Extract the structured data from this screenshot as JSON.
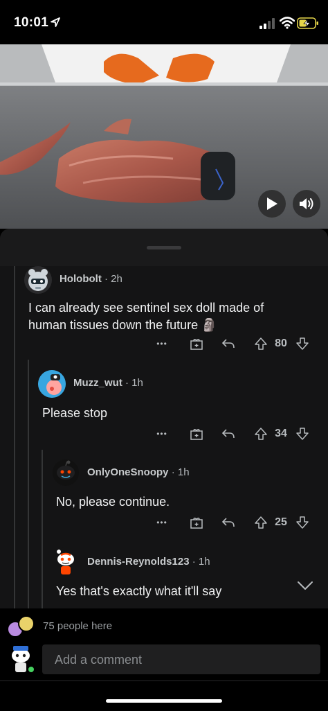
{
  "status_bar": {
    "time": "10:01"
  },
  "video": {
    "play_icon": "play-icon",
    "sound_icon": "speaker-icon"
  },
  "comments": [
    {
      "user": "Holobolt",
      "age": "2h",
      "text": "I can already see sentinel sex doll made of human tissues down the future",
      "emoji": "🗿",
      "votes": "80"
    },
    {
      "user": "Muzz_wut",
      "age": "1h",
      "text": "Please stop",
      "votes": "34"
    },
    {
      "user": "OnlyOneSnoopy",
      "age": "1h",
      "text": "No, please continue.",
      "votes": "25"
    },
    {
      "user": "Dennis-Reynolds123",
      "age": "1h",
      "text": "Yes that's exactly what it'll say"
    }
  ],
  "meta_separator": "·",
  "more_label": "•••",
  "footer": {
    "people_here": "75 people here",
    "comment_placeholder": "Add a comment"
  },
  "colors": {
    "sheet": "#1a1a1b",
    "comments_bg": "#141415",
    "text": "#f1f2f3",
    "meta": "#b8bcbf"
  }
}
